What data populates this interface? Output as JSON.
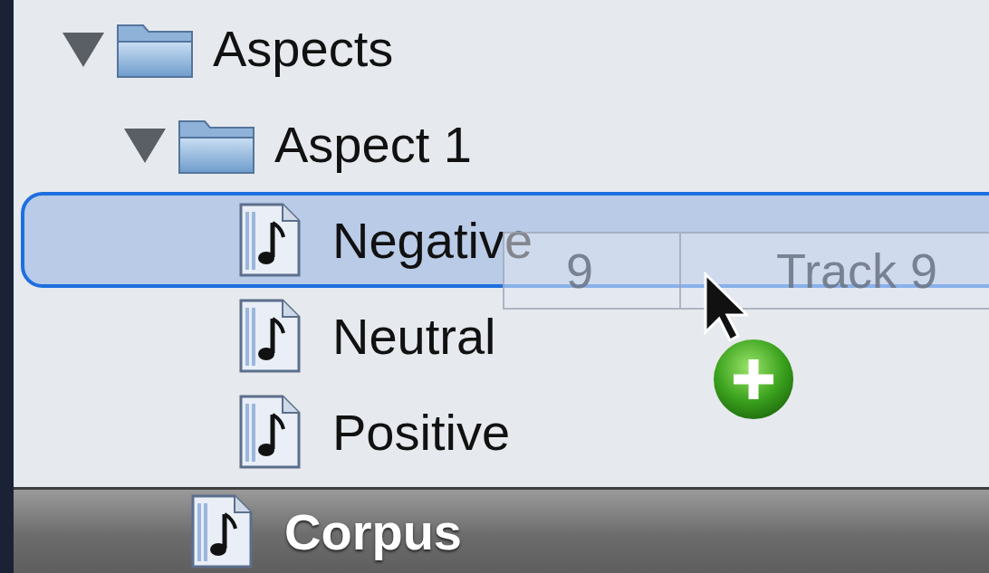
{
  "tree": [
    {
      "label": "Aspects",
      "kind": "folder",
      "expanded": true,
      "selected": false,
      "children": [
        {
          "label": "Aspect 1",
          "kind": "folder",
          "expanded": true,
          "selected": false,
          "children": [
            {
              "label": "Negative",
              "kind": "file",
              "selected": true
            },
            {
              "label": "Neutral",
              "kind": "file",
              "selected": false
            },
            {
              "label": "Positive",
              "kind": "file",
              "selected": false
            }
          ]
        }
      ]
    }
  ],
  "source_header": {
    "label": "Corpus"
  },
  "drag_ghost": {
    "column_1": "9",
    "column_2": "Track 9"
  }
}
